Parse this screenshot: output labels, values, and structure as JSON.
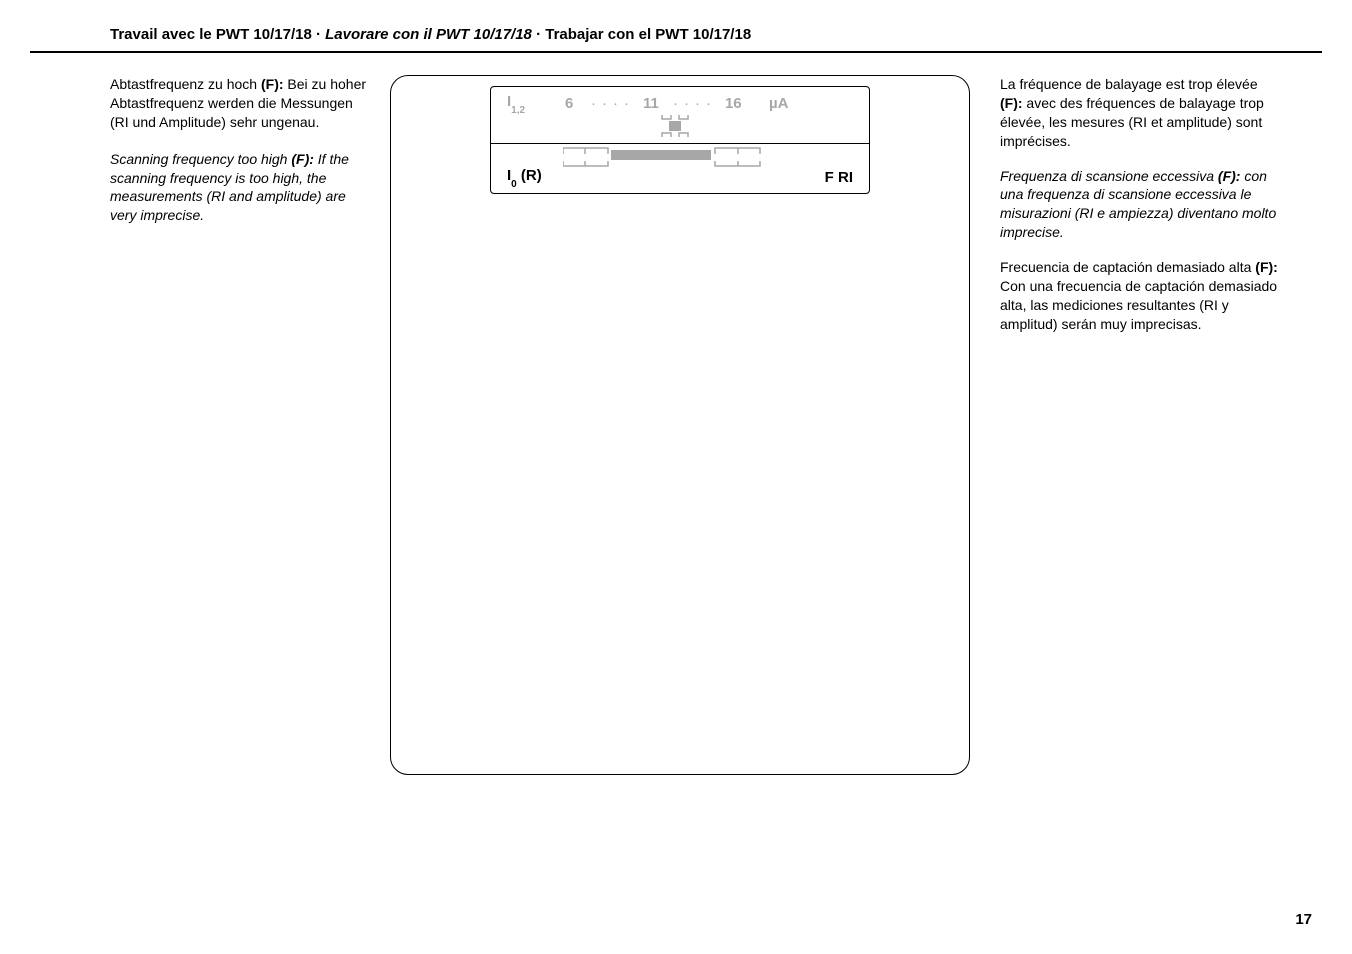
{
  "header": {
    "part_fr": "Travail avec le PWT 10/17/18 · ",
    "part_it": "Lavorare con il PWT 10/17/18",
    "part_es": " · Trabajar con el PWT 10/17/18"
  },
  "left": {
    "de_pre": "Abtastfrequenz zu hoch ",
    "de_bold": "(F):",
    "de_post": " Bei zu hoher Abtastfrequenz werden die Messungen (RI und Amplitude) sehr ungenau.",
    "en_pre": "Scanning frequency too high ",
    "en_bold": "(F):",
    "en_post": " If the scanning frequency is too high, the measurements (RI and amplitude) are very imprecise."
  },
  "display": {
    "i12_label": "I",
    "i12_sub": "1,2",
    "num6": "6",
    "dot_pattern": "····",
    "num11": "11",
    "num16": "16",
    "ua": "µA",
    "i0_label": "I",
    "i0_sub": "0",
    "i0_suffix": " (R)",
    "fri": "F RI"
  },
  "right": {
    "fr_pre": "La fréquence de balayage est trop élevée ",
    "fr_bold": "(F):",
    "fr_post": " avec des fréquences de balayage trop élevée, les mesures (RI et amplitude) sont imprécises.",
    "it_pre": "Frequenza di scansione eccessiva ",
    "it_bold": "(F):",
    "it_post": " con una frequenza di scansione eccessiva le misurazioni (RI e ampiezza) diventano molto imprecise.",
    "es_pre": "Frecuencia de captación demasiado alta ",
    "es_bold": "(F):",
    "es_post": " Con una frecuencia de captación demasiado alta, las mediciones resultantes (RI y amplitud) serán muy imprecisas."
  },
  "page_number": "17"
}
